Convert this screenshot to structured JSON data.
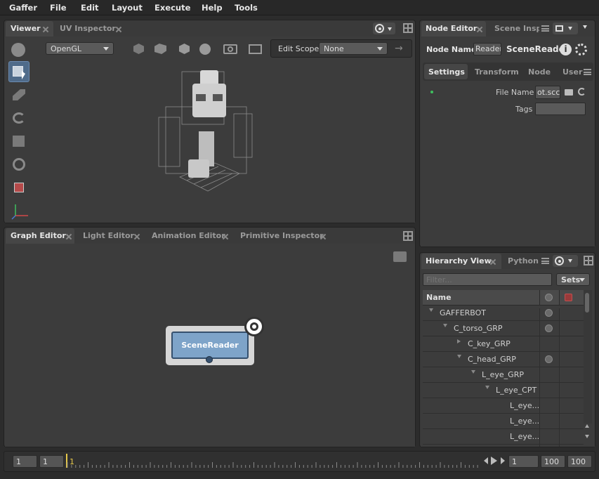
{
  "menubar": {
    "items": [
      "Gaffer",
      "File",
      "Edit",
      "Layout",
      "Execute",
      "Help",
      "Tools"
    ]
  },
  "viewer": {
    "tabs": [
      {
        "label": "Viewer",
        "active": true
      },
      {
        "label": "UV Inspector",
        "active": false
      }
    ],
    "renderer": "OpenGL",
    "edit_scope_label": "Edit Scope",
    "edit_scope_value": "None"
  },
  "graph": {
    "tabs": [
      {
        "label": "Graph Editor",
        "active": true
      },
      {
        "label": "Light Editor",
        "active": false
      },
      {
        "label": "Animation Editor",
        "active": false
      },
      {
        "label": "Primitive Inspector",
        "active": false
      }
    ],
    "node_label": "SceneReader"
  },
  "node_editor": {
    "tabs": [
      {
        "label": "Node Editor",
        "active": true
      },
      {
        "label": "Scene Insp",
        "active": false
      }
    ],
    "node_name_label": "Node Name",
    "node_name_value": "Reader",
    "node_title": "SceneReader",
    "subtabs": [
      "Settings",
      "Transform",
      "Node",
      "User"
    ],
    "file_name_label": "File Name",
    "file_name_value": "ot.scc",
    "tags_label": "Tags",
    "tags_value": ""
  },
  "hierarchy": {
    "tabs": [
      {
        "label": "Hierarchy View",
        "active": true
      },
      {
        "label": "Python",
        "active": false
      }
    ],
    "filter_placeholder": "Filter...",
    "sets_label": "Sets",
    "col_name": "Name",
    "rows": [
      {
        "label": "GAFFERBOT",
        "expanded": true,
        "has_children": true,
        "icon": true
      },
      {
        "label": "C_torso_GRP",
        "expanded": true,
        "has_children": true,
        "icon": true
      },
      {
        "label": "C_key_GRP",
        "expanded": false,
        "has_children": true,
        "icon": false
      },
      {
        "label": "C_head_GRP",
        "expanded": true,
        "has_children": true,
        "icon": true
      },
      {
        "label": "L_eye_GRP",
        "expanded": true,
        "has_children": true,
        "icon": false
      },
      {
        "label": "L_eye_CPT",
        "expanded": true,
        "has_children": true,
        "icon": false
      },
      {
        "label": "L_eye...",
        "expanded": false,
        "has_children": false,
        "icon": false
      },
      {
        "label": "L_eye...",
        "expanded": false,
        "has_children": false,
        "icon": false
      },
      {
        "label": "L_eye...",
        "expanded": false,
        "has_children": false,
        "icon": false
      }
    ]
  },
  "timeline": {
    "start_outer": "1",
    "start_inner": "1",
    "current": "1",
    "frame": "1",
    "end_inner": "100",
    "end_outer": "100"
  },
  "colors": {
    "accent_blue": "#4f6b8a",
    "node_fill": "#7ea4c9",
    "status_green": "#3fbf5f"
  }
}
